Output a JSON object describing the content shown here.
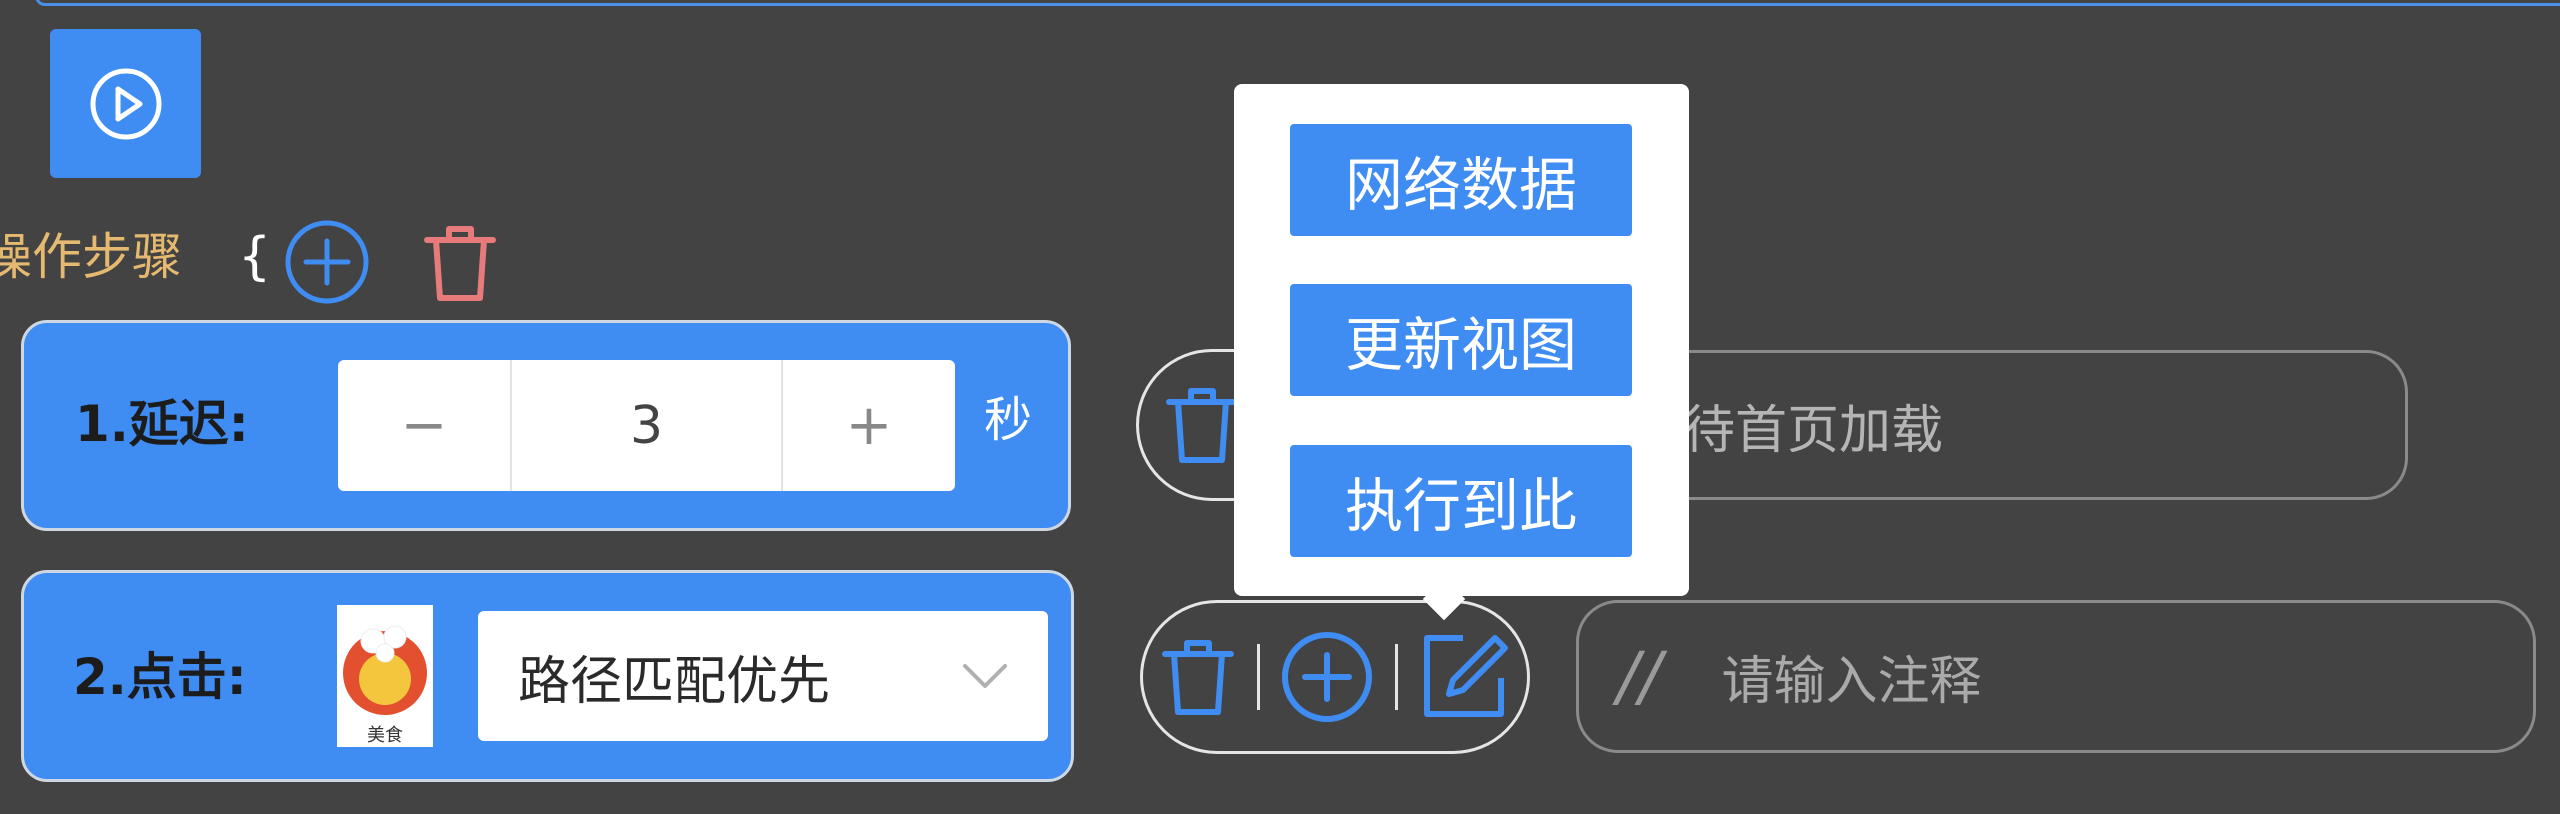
{
  "section": {
    "label": "操作步骤",
    "brace": "{"
  },
  "colors": {
    "accent": "#3F8CF3",
    "danger": "#E77A7A",
    "label_gold": "#E5B970",
    "background": "#434343"
  },
  "icons": {
    "play": "play-circle-icon",
    "add": "plus-circle-icon",
    "delete": "trash-icon",
    "edit": "edit-icon",
    "chevron": "chevron-down-icon"
  },
  "steps": [
    {
      "label": "1.延迟:",
      "minus_label": "−",
      "value": "3",
      "plus_label": "+",
      "unit": "秒",
      "note_visible_text": "待首页加载"
    },
    {
      "label": "2.点击:",
      "thumbnail_caption": "美食",
      "match_mode": "路径匹配优先",
      "note_prefix": "//",
      "note_placeholder": "请输入注释"
    }
  ],
  "popover": {
    "items": [
      "网络数据",
      "更新视图",
      "执行到此"
    ]
  }
}
